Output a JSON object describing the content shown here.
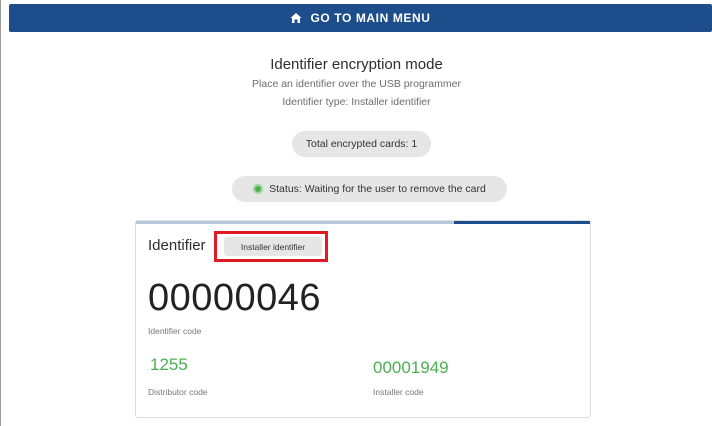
{
  "header": {
    "button_label": "GO TO MAIN MENU",
    "icon": "home-icon"
  },
  "main": {
    "title": "Identifier encryption mode",
    "instruction": "Place an identifier over the USB programmer",
    "identifier_type_line": "Identifier type: Installer identifier",
    "total_encrypted": "Total encrypted cards: 1",
    "status": "Status: Waiting for the user to remove the card",
    "status_color": "#4caf50"
  },
  "card": {
    "heading": "Identifier",
    "type_badge": "Installer identifier",
    "progress": 0.3,
    "identifier_code": "00000046",
    "identifier_code_label": "Identifier code",
    "distributor_code": "1255",
    "distributor_code_label": "Distributor code",
    "installer_code": "00001949",
    "installer_code_label": "Installer code"
  },
  "colors": {
    "accent": "#1e4d8c",
    "code_green": "#4caf50",
    "highlight_red": "#e01b24"
  }
}
